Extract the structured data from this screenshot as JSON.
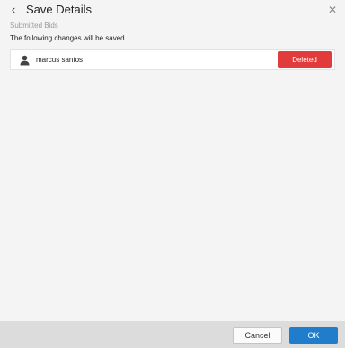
{
  "header": {
    "back_icon": "chevron-left-icon",
    "title": "Save Details",
    "close_icon": "close-icon"
  },
  "subtitle": "Submitted Bids",
  "description": "The following changes will be saved",
  "changes": [
    {
      "icon": "user-icon",
      "name": "marcus santos",
      "status": "Deleted",
      "status_color": "#e23b3b"
    }
  ],
  "footer": {
    "cancel_label": "Cancel",
    "ok_label": "OK",
    "ok_color": "#1f7dcc"
  }
}
